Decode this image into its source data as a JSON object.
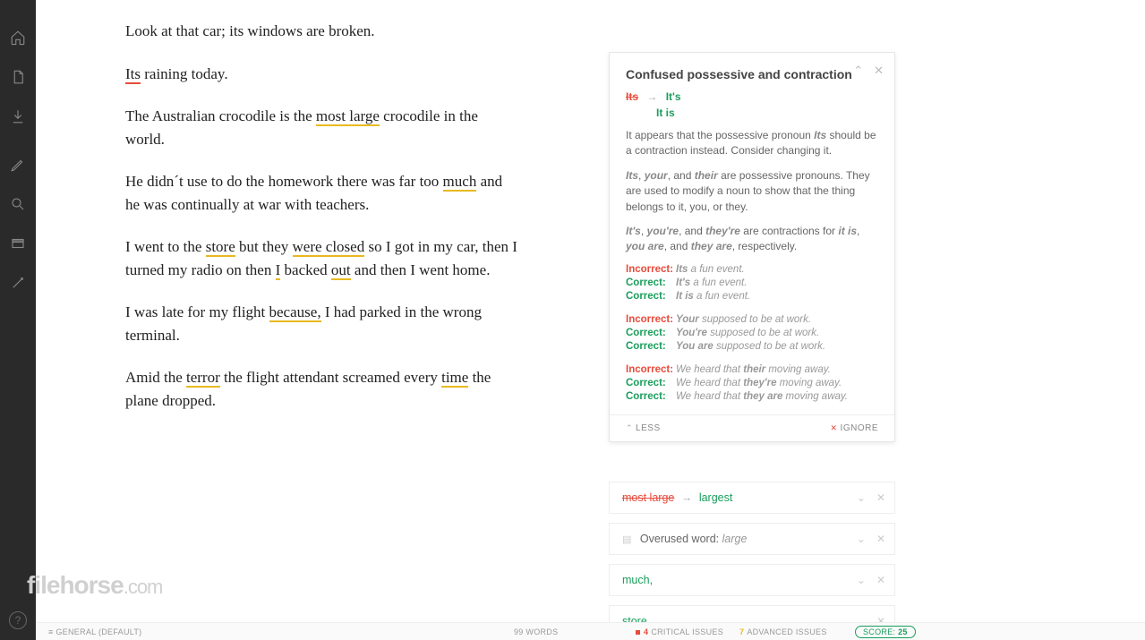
{
  "sidebar": {
    "help": "?"
  },
  "editor": {
    "p1_a": "Look at that car; its windows are broken.",
    "p2_err": "Its",
    "p2_b": " raining today.",
    "p3_a": "The Australian crocodile is the ",
    "p3_err": "most large",
    "p3_b": " crocodile in the world.",
    "p4_a": "He didn´t use to do the homework there was far too ",
    "p4_err": "much",
    "p4_b": " and he was continually at war with teachers.",
    "p5_a": "I went to the ",
    "p5_e1": "store",
    "p5_b": " but they ",
    "p5_e2": "were closed",
    "p5_c": " so I got in my car, then I turned my radio on then ",
    "p5_e3": "I",
    "p5_d": " backed ",
    "p5_e4": "out",
    "p5_e": " and then I went home.",
    "p6_a": "I was late for my flight ",
    "p6_err": "because,",
    "p6_b": " I had parked in the wrong terminal.",
    "p7_a": "Amid the ",
    "p7_e1": "terror",
    "p7_b": " the flight attendant screamed every ",
    "p7_e2": "time",
    "p7_c": " the plane dropped."
  },
  "card": {
    "title": "Confused possessive and contraction",
    "from": "Its",
    "to": "It's",
    "alt": "It is",
    "exp1_a": "It appears that the possessive pronoun ",
    "exp1_p": "Its",
    "exp1_b": " should be a contraction instead. Consider changing it.",
    "exp2_a": "Its",
    "exp2_b": "your",
    "exp2_c": "their",
    "exp2_d": " are possessive pronouns. They are used to modify a noun to show that the thing belongs to it, you, or they.",
    "exp3_a": "It's",
    "exp3_b": "you're",
    "exp3_c": "they're",
    "exp3_d": " are contractions for ",
    "exp3_e": "it is",
    "exp3_f": "you are",
    "exp3_g": "they are",
    "exp3_h": ", respectively.",
    "labels": {
      "inc": "Incorrect:",
      "cor": "Correct:"
    },
    "ex1": {
      "r1_p": "Its",
      "r1_t": " a fun event.",
      "r2_p": "It's",
      "r2_t": " a fun event.",
      "r3_p": "It is",
      "r3_t": " a fun event."
    },
    "ex2": {
      "r1_p": "Your",
      "r1_t": " supposed to be at work.",
      "r2_p": "You're",
      "r2_t": " supposed to be at work.",
      "r3_p": "You are",
      "r3_t": " supposed to be at work."
    },
    "ex3": {
      "r1_a": "We heard that ",
      "r1_p": "their",
      "r1_t": " moving away.",
      "r2_a": "We heard that ",
      "r2_p": "they're",
      "r2_t": " moving away.",
      "r3_a": "We heard that ",
      "r3_p": "they are",
      "r3_t": " moving away."
    },
    "less": "LESS",
    "ignore": "IGNORE"
  },
  "mini": {
    "m1_from": "most large",
    "m1_to": "largest",
    "m2_a": "Overused word: ",
    "m2_b": "large",
    "m3": "much,",
    "m4": "store,"
  },
  "status": {
    "doctype": "GENERAL (DEFAULT)",
    "words": "99 WORDS",
    "crit_n": "4",
    "crit_l": "CRITICAL ISSUES",
    "adv_n": "7",
    "adv_l": "ADVANCED ISSUES",
    "score_l": "SCORE:",
    "score_v": "25"
  },
  "watermark": {
    "a": "filehorse",
    "b": ".com"
  }
}
